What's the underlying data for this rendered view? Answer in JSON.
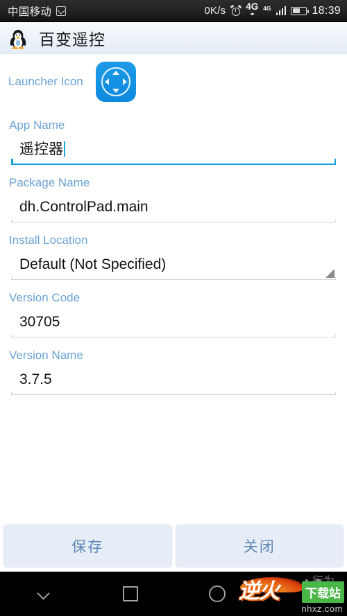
{
  "status_bar": {
    "carrier": "中国移动",
    "sim_icon": "sim-card-icon",
    "net_speed": "0K/s",
    "alarm_icon": "alarm-clock-icon",
    "network_type_primary": "4G",
    "network_type_primary_sub": "◂▸",
    "network_type_secondary": "4G",
    "signal_icon": "signal-bars-icon",
    "battery_icon": "battery-icon",
    "clock": "18:39"
  },
  "title_bar": {
    "app_icon": "tux-penguin-icon",
    "title": "百变遥控"
  },
  "form": {
    "launcher": {
      "label": "Launcher Icon",
      "icon_name": "dpad-launcher-icon",
      "icon_color": "#0d8ade"
    },
    "fields": [
      {
        "label": "App Name",
        "value": "遥控器",
        "type": "text",
        "focused": true
      },
      {
        "label": "Package Name",
        "value": "dh.ControlPad.main",
        "type": "text",
        "focused": false
      },
      {
        "label": "Install Location",
        "value": "Default (Not Specified)",
        "type": "spinner",
        "focused": false
      },
      {
        "label": "Version Code",
        "value": "30705",
        "type": "text",
        "focused": false
      },
      {
        "label": "Version Name",
        "value": "3.7.5",
        "type": "text",
        "focused": false
      }
    ]
  },
  "buttons": {
    "save_label": "保存",
    "close_label": "关闭"
  },
  "nav_bar": {
    "back_icon": "chevron-down-icon",
    "recents_icon": "square-icon",
    "home_icon": "circle-icon"
  },
  "watermark": {
    "brand": "逆火",
    "badge": "下载站",
    "url": "nhxz.com",
    "faint": "行为"
  },
  "colors": {
    "label_blue": "#6ba3d6",
    "focus_blue": "#18a0dc",
    "button_bg": "#e7edf7",
    "button_text": "#5b87b5",
    "accent": "#0d8ade"
  }
}
